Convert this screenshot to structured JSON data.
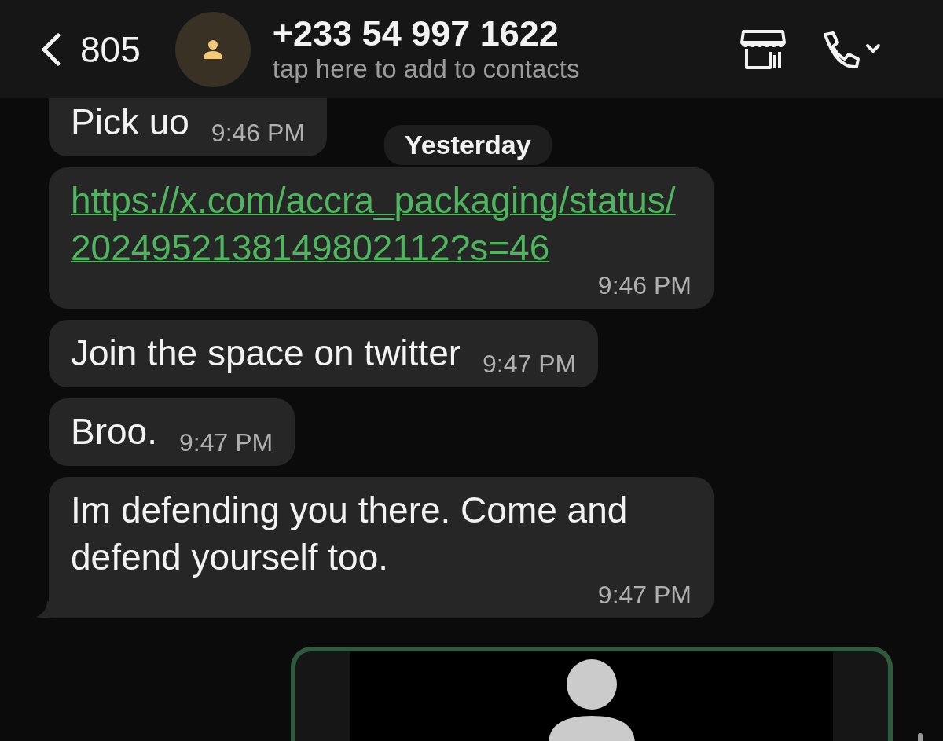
{
  "header": {
    "back_count": "805",
    "phone": "+233 54 997 1622",
    "subtitle": "tap here to add to contacts"
  },
  "date_chip": "Yesterday",
  "messages": [
    {
      "kind": "text",
      "text": "Pick uo",
      "time": "9:46 PM",
      "tail": false
    },
    {
      "kind": "link",
      "text": "https://x.com/accra_packaging/status/2024952138149802112?s=46",
      "time": "9:46 PM",
      "tail": false
    },
    {
      "kind": "text",
      "text": "Join the space on twitter",
      "time": "9:47 PM",
      "tail": false
    },
    {
      "kind": "text",
      "text": "Broo.",
      "time": "9:47 PM",
      "tail": false
    },
    {
      "kind": "text",
      "text": "Im defending you there. Come and defend yourself too.",
      "time": "9:47 PM",
      "tail": true
    }
  ],
  "outgoing": {
    "kind": "contact_card"
  }
}
